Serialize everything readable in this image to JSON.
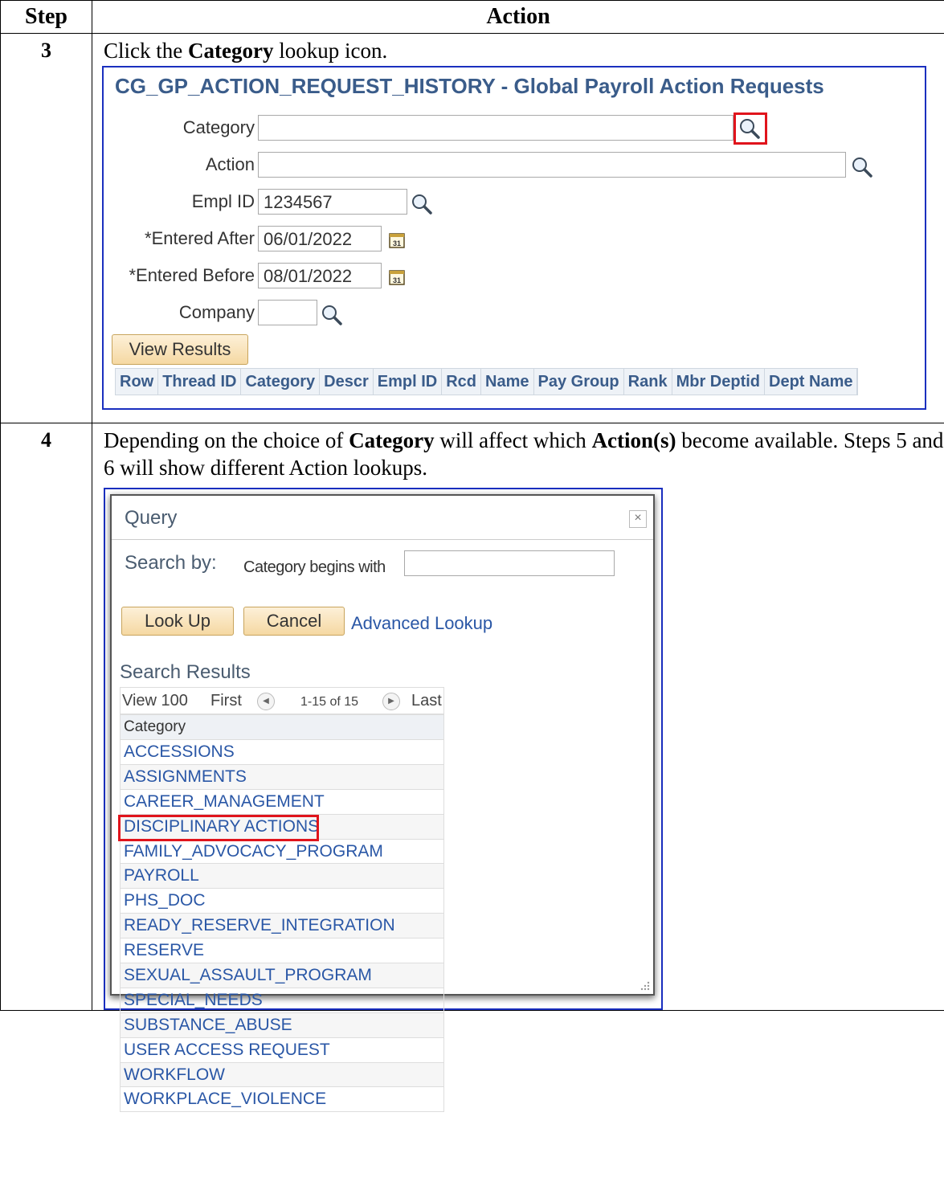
{
  "table": {
    "col_step": "Step",
    "col_action": "Action"
  },
  "steps": [
    {
      "number": "3",
      "pre": "Click the ",
      "bold": "Category",
      "post": " lookup icon."
    },
    {
      "number": "4",
      "t1": "Depending on the choice of ",
      "b1": "Category",
      "t2": " will affect which ",
      "b2": "Action(s)",
      "t3": " become available. Steps 5 and 6 will show different Action lookups."
    }
  ],
  "search_page": {
    "title": "CG_GP_ACTION_REQUEST_HISTORY - Global Payroll Action Requests",
    "fields": {
      "category_label": "Category",
      "category_value": "",
      "action_label": "Action",
      "action_value": "",
      "emplid_label": "Empl ID",
      "emplid_value": "1234567",
      "entered_after_label": "*Entered After",
      "entered_after_value": "06/01/2022",
      "entered_before_label": "*Entered Before",
      "entered_before_value": "08/01/2022",
      "company_label": "Company",
      "company_value": ""
    },
    "view_results": "View Results",
    "columns": [
      "Row",
      "Thread ID",
      "Category",
      "Descr",
      "Empl ID",
      "Rcd",
      "Name",
      "Pay Group",
      "Rank",
      "Mbr Deptid",
      "Dept Name"
    ]
  },
  "query_modal": {
    "title": "Query",
    "close": "×",
    "search_by": "Search by:",
    "search_field_label": "Category begins with",
    "search_value": "",
    "look_up": "Look Up",
    "cancel": "Cancel",
    "advanced": "Advanced Lookup",
    "results_heading": "Search Results",
    "nav": {
      "view": "View 100",
      "first": "First",
      "range": "1-15 of 15",
      "last": "Last"
    },
    "column": "Category",
    "results": [
      "ACCESSIONS",
      "ASSIGNMENTS",
      "CAREER_MANAGEMENT",
      "DISCIPLINARY ACTIONS",
      "FAMILY_ADVOCACY_PROGRAM",
      "PAYROLL",
      "PHS_DOC",
      "READY_RESERVE_INTEGRATION",
      "RESERVE",
      "SEXUAL_ASSAULT_PROGRAM",
      "SPECIAL_NEEDS",
      "SUBSTANCE_ABUSE",
      "USER ACCESS REQUEST",
      "WORKFLOW",
      "WORKPLACE_VIOLENCE"
    ],
    "highlighted_result": "DISCIPLINARY ACTIONS"
  },
  "colors": {
    "highlight": "#e0141c",
    "frame": "#1a2fbf",
    "link": "#2a57a6",
    "peoplesoft_title": "#3a5c8a"
  }
}
